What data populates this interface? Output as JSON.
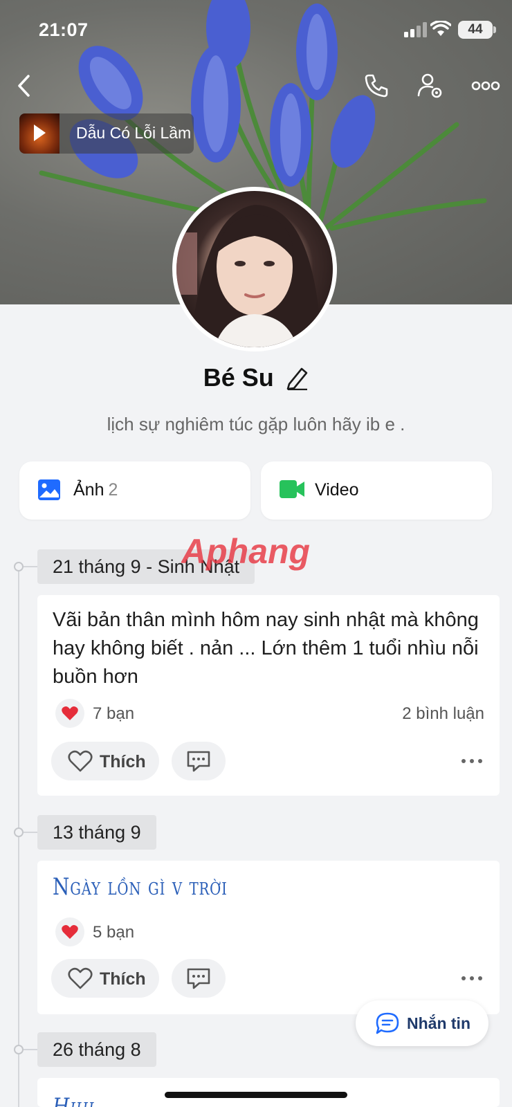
{
  "status_bar": {
    "time": "21:07",
    "battery": "44"
  },
  "header": {
    "back_icon": "chevron-left-icon",
    "call_icon": "phone-icon",
    "settings_icon": "user-settings-icon",
    "more_icon": "more-horizontal-icon"
  },
  "music": {
    "title": "Dẫu Có Lỗi Lầm"
  },
  "profile": {
    "name": "Bé Su",
    "bio": "lịch sự nghiêm túc gặp luôn hãy ib e ."
  },
  "media": {
    "photos_label": "Ảnh",
    "photos_count": "2",
    "video_label": "Video"
  },
  "timeline": [
    {
      "date": "21 tháng 9 - Sinh Nhật",
      "text": "Vãi bản thân mình hôm nay sinh nhật mà không hay không biết . nản ... Lớn thêm 1 tuổi nhìu nỗi buồn hơn",
      "reactions": "7 bạn",
      "comments": "2 bình luận",
      "like_label": "Thích"
    },
    {
      "date": "13 tháng 9",
      "text": "Ngày lồn gì v trời",
      "reactions": "5 bạn",
      "like_label": "Thích"
    },
    {
      "date": "26 tháng 8",
      "text": "Hihi"
    }
  ],
  "fab": {
    "label": "Nhắn tin"
  },
  "watermark": {
    "text": "Aphang"
  },
  "colors": {
    "accent": "#1f6bff",
    "video_green": "#27c25b",
    "heart": "#e52d3a",
    "deco_blue": "#2b5fb8"
  }
}
